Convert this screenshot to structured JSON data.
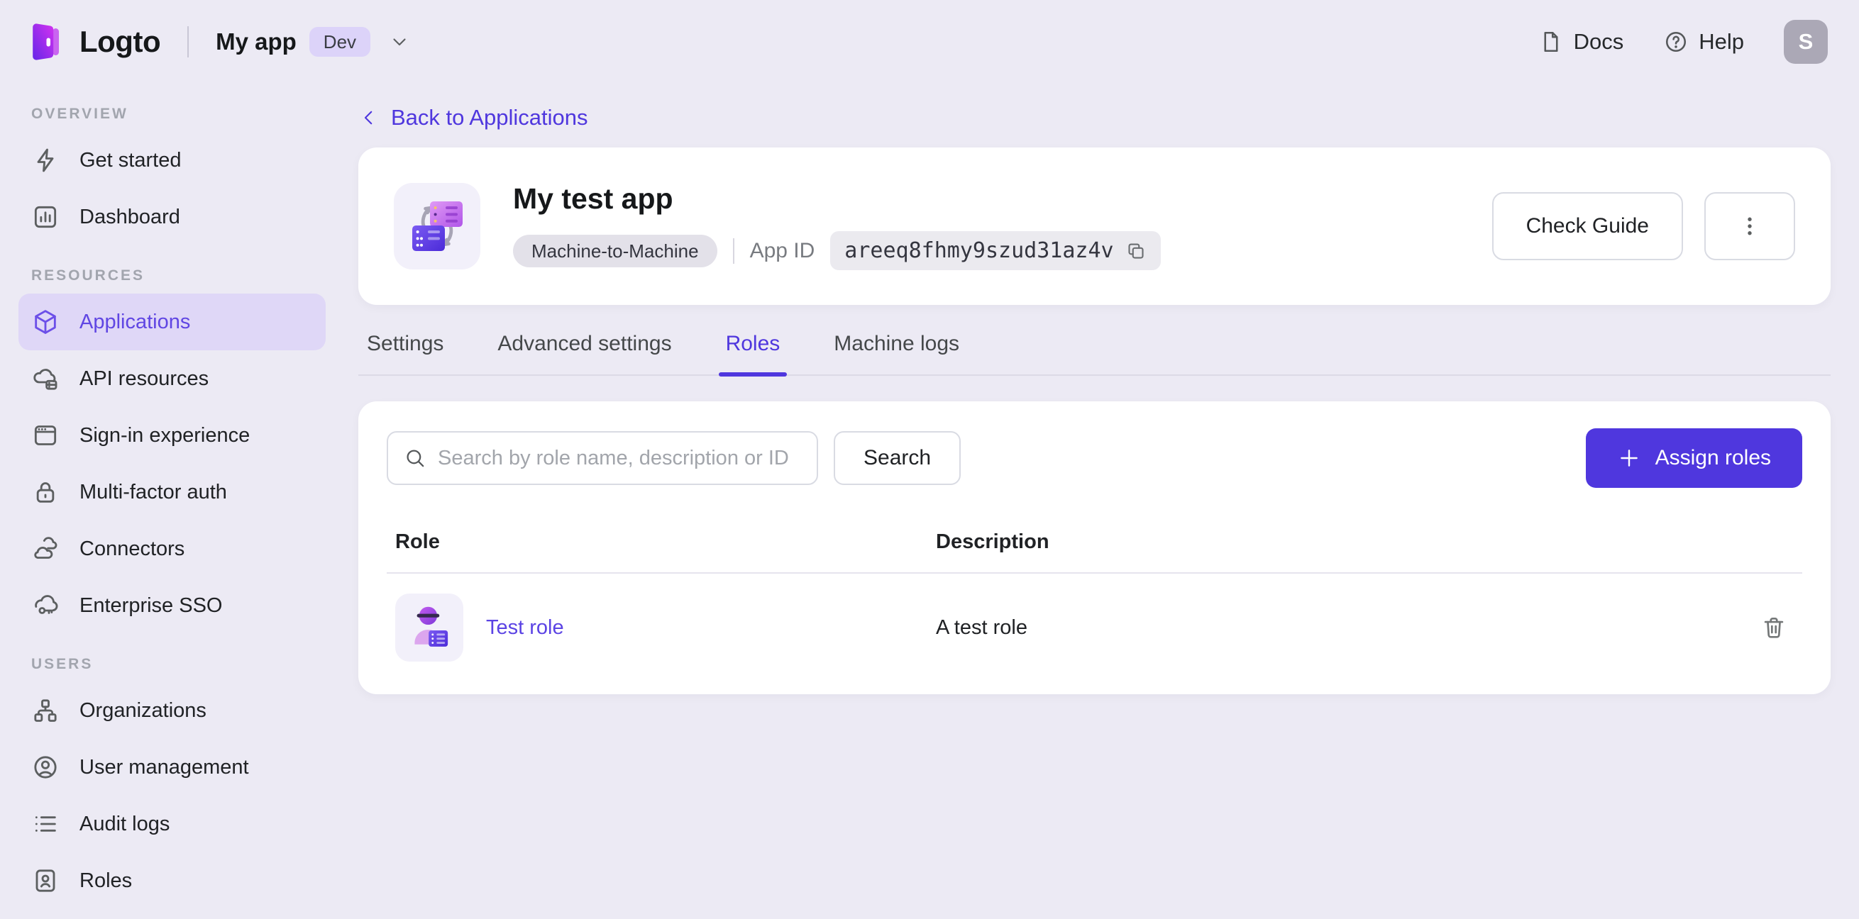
{
  "colors": {
    "page_bg": "#ECEAF4",
    "card_bg": "#FFFFFF",
    "accent": "#4F37DE",
    "sidebar_active_bg": "#DFD7F7",
    "link": "#5B43E4"
  },
  "topbar": {
    "brand": "Logto",
    "app_name": "My app",
    "env_badge": "Dev",
    "docs_label": "Docs",
    "help_label": "Help",
    "avatar_initial": "S"
  },
  "sidebar": {
    "sections": [
      {
        "label": "OVERVIEW",
        "items": [
          {
            "label": "Get started",
            "icon": "lightning-icon",
            "active": false
          },
          {
            "label": "Dashboard",
            "icon": "bar-chart-icon",
            "active": false
          }
        ]
      },
      {
        "label": "RESOURCES",
        "items": [
          {
            "label": "Applications",
            "icon": "cube-icon",
            "active": true
          },
          {
            "label": "API resources",
            "icon": "cloud-box-icon",
            "active": false
          },
          {
            "label": "Sign-in experience",
            "icon": "browser-icon",
            "active": false
          },
          {
            "label": "Multi-factor auth",
            "icon": "lock-icon",
            "active": false
          },
          {
            "label": "Connectors",
            "icon": "clouds-icon",
            "active": false
          },
          {
            "label": "Enterprise SSO",
            "icon": "cloud-key-icon",
            "active": false
          }
        ]
      },
      {
        "label": "USERS",
        "items": [
          {
            "label": "Organizations",
            "icon": "org-chart-icon",
            "active": false
          },
          {
            "label": "User management",
            "icon": "user-circle-icon",
            "active": false
          },
          {
            "label": "Audit logs",
            "icon": "list-icon",
            "active": false
          },
          {
            "label": "Roles",
            "icon": "id-card-icon",
            "active": false
          }
        ]
      }
    ]
  },
  "main": {
    "back_link": "Back to Applications",
    "app": {
      "title": "My test app",
      "type_tag": "Machine-to-Machine",
      "app_id_label": "App ID",
      "app_id": "areeq8fhmy9szud31az4v"
    },
    "actions": {
      "check_guide": "Check Guide"
    },
    "tabs": [
      {
        "label": "Settings",
        "active": false
      },
      {
        "label": "Advanced settings",
        "active": false
      },
      {
        "label": "Roles",
        "active": true
      },
      {
        "label": "Machine logs",
        "active": false
      }
    ],
    "roles_panel": {
      "search_placeholder": "Search by role name, description or ID",
      "search_button": "Search",
      "assign_button": "Assign roles",
      "table": {
        "headers": [
          "Role",
          "Description"
        ],
        "rows": [
          {
            "role": "Test role",
            "description": "A test role"
          }
        ]
      }
    }
  }
}
